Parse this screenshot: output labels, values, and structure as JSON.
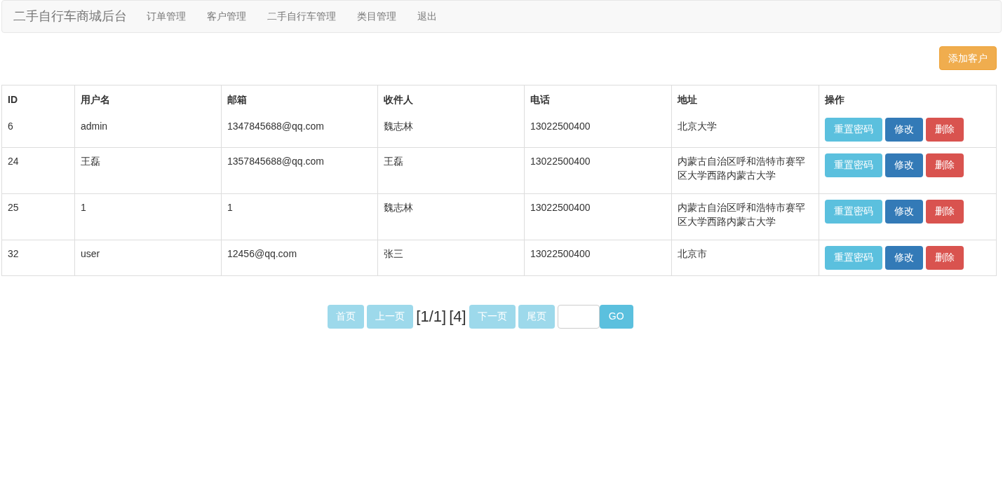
{
  "navbar": {
    "brand": "二手自行车商城后台",
    "items": [
      "订单管理",
      "客户管理",
      "二手自行车管理",
      "类目管理",
      "退出"
    ]
  },
  "add_button": "添加客户",
  "table": {
    "columns": [
      "ID",
      "用户名",
      "邮箱",
      "收件人",
      "电话",
      "地址",
      "操作"
    ],
    "rows": [
      {
        "cells": [
          "6",
          "admin",
          "1347845688@qq.com",
          "魏志林",
          "13022500400",
          "北京大学"
        ],
        "actions": [
          "重置密码",
          "修改",
          "删除"
        ]
      },
      {
        "cells": [
          "24",
          "王磊",
          "1357845688@qq.com",
          "王磊",
          "13022500400",
          "内蒙古自治区呼和浩特市赛罕区大学西路内蒙古大学"
        ],
        "actions": [
          "重置密码",
          "修改",
          "删除"
        ]
      },
      {
        "cells": [
          "25",
          "1",
          "1",
          "魏志林",
          "13022500400",
          "内蒙古自治区呼和浩特市赛罕区大学西路内蒙古大学"
        ],
        "actions": [
          "重置密码",
          "修改",
          "删除"
        ]
      },
      {
        "cells": [
          "32",
          "user",
          "12456@qq.com",
          "张三",
          "13022500400",
          "北京市"
        ],
        "actions": [
          "重置密码",
          "修改",
          "删除"
        ]
      }
    ]
  },
  "pagination": {
    "first": {
      "label": "首页",
      "disabled": true
    },
    "prev": {
      "label": "上一页",
      "disabled": true
    },
    "page_info": "[1/1]",
    "total": "[4]",
    "next": {
      "label": "下一页",
      "disabled": true
    },
    "last": {
      "label": "尾页",
      "disabled": true
    },
    "go": "GO"
  }
}
